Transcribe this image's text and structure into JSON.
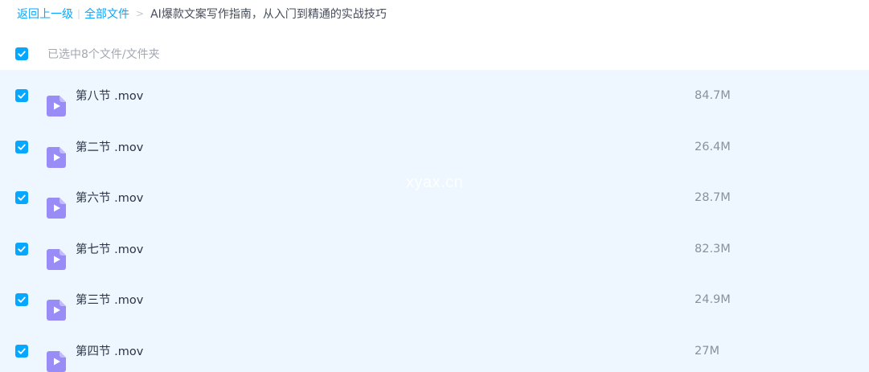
{
  "breadcrumb": {
    "back_label": "返回上一级",
    "separator": "|",
    "all_files_label": "全部文件",
    "arrow": ">",
    "current_folder": "AI爆款文案写作指南，从入门到精通的实战技巧"
  },
  "selection": {
    "label": "已选中8个文件/文件夹",
    "checked": true
  },
  "colors": {
    "accent": "#06a7ff",
    "list_background": "#eef7ff",
    "video_icon": "#9a8cf6"
  },
  "files": [
    {
      "name": "第八节 .mov",
      "size": "84.7M",
      "icon": "video-file-icon",
      "checked": true
    },
    {
      "name": "第二节 .mov",
      "size": "26.4M",
      "icon": "video-file-icon",
      "checked": true
    },
    {
      "name": "第六节 .mov",
      "size": "28.7M",
      "icon": "video-file-icon",
      "checked": true
    },
    {
      "name": "第七节 .mov",
      "size": "82.3M",
      "icon": "video-file-icon",
      "checked": true
    },
    {
      "name": "第三节 .mov",
      "size": "24.9M",
      "icon": "video-file-icon",
      "checked": true
    },
    {
      "name": "第四节 .mov",
      "size": "27M",
      "icon": "video-file-icon",
      "checked": true
    }
  ],
  "watermark": "xyax.cn"
}
